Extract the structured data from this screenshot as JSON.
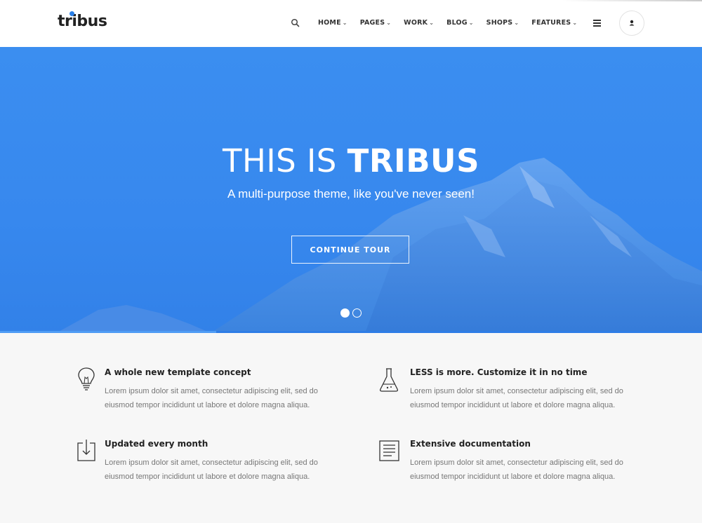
{
  "header": {
    "logo": "tribus",
    "nav": [
      {
        "label": "HOME"
      },
      {
        "label": "PAGES"
      },
      {
        "label": "WORK"
      },
      {
        "label": "BLOG"
      },
      {
        "label": "SHOPS"
      },
      {
        "label": "FEATURES"
      }
    ],
    "icons": {
      "search": "search-icon",
      "menu": "hamburger-menu-icon",
      "user": "user-icon"
    }
  },
  "hero": {
    "title_light": "THIS IS",
    "title_bold": "TRIBUS",
    "subtitle": "A multi-purpose theme, like you've never seen!",
    "button": "CONTINUE TOUR",
    "slides": 2,
    "active_slide": 1,
    "background_color": "#3a8cef"
  },
  "features": [
    {
      "icon": "lightbulb-icon",
      "title": "A whole new template concept",
      "text": "Lorem ipsum dolor sit amet, consectetur adipiscing elit, sed do eiusmod tempor incididunt ut labore et dolore magna aliqua."
    },
    {
      "icon": "flask-icon",
      "title": "LESS is more. Customize it in no time",
      "text": "Lorem ipsum dolor sit amet, consectetur adipiscing elit, sed do eiusmod tempor incididunt ut labore et dolore magna aliqua."
    },
    {
      "icon": "download-icon",
      "title": "Updated every month",
      "text": "Lorem ipsum dolor sit amet, consectetur adipiscing elit, sed do eiusmod tempor incididunt ut labore et dolore magna aliqua."
    },
    {
      "icon": "document-icon",
      "title": "Extensive documentation",
      "text": "Lorem ipsum dolor sit amet, consectetur adipiscing elit, sed do eiusmod tempor incididunt ut labore et dolore magna aliqua."
    }
  ]
}
